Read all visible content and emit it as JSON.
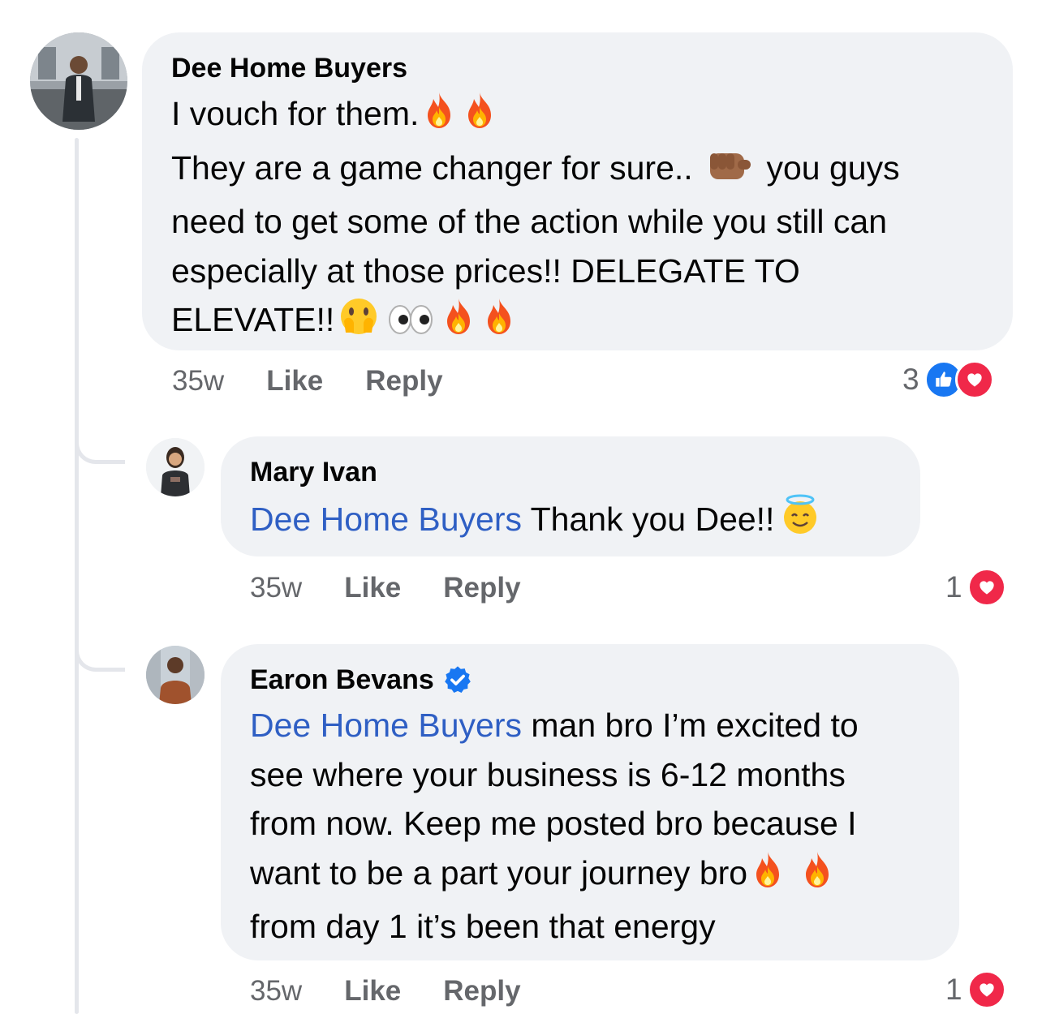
{
  "comments": [
    {
      "author": "Dee Home Buyers",
      "lines": [
        "I vouch for them.",
        "They are a game changer for sure..",
        "you guys",
        "need to get some of the action while you still can",
        "especially at those prices!! DELEGATE TO",
        "ELEVATE!!"
      ],
      "time": "35w",
      "like_label": "Like",
      "reply_label": "Reply",
      "reaction_count": "3",
      "reactions": [
        "like-icon",
        "love-icon"
      ]
    },
    {
      "author": "Mary Ivan",
      "mention": "Dee Home Buyers",
      "text": " Thank you Dee!!",
      "time": "35w",
      "like_label": "Like",
      "reply_label": "Reply",
      "reaction_count": "1",
      "reactions": [
        "love-icon"
      ]
    },
    {
      "author": "Earon Bevans",
      "verified": true,
      "mention": "Dee Home Buyers",
      "lines": [
        " man bro I’m excited to",
        "see where your business is 6-12 months",
        "from now. Keep me posted bro because I",
        "want to be a part your journey bro",
        "from day 1 it’s been that energy"
      ],
      "time": "35w",
      "like_label": "Like",
      "reply_label": "Reply",
      "reaction_count": "1",
      "reactions": [
        "love-icon"
      ]
    }
  ],
  "colors": {
    "bubble": "#f0f2f5",
    "mention": "#2f5fc4",
    "meta": "#65676b",
    "like_blue": "#1877f2",
    "love_red": "#f02849",
    "thread_line": "#e4e6eb"
  },
  "icons": [
    "fire-emoji",
    "fist-emoji",
    "hand-over-mouth-emoji",
    "eyes-emoji",
    "halo-smile-emoji",
    "verified-badge-icon"
  ]
}
